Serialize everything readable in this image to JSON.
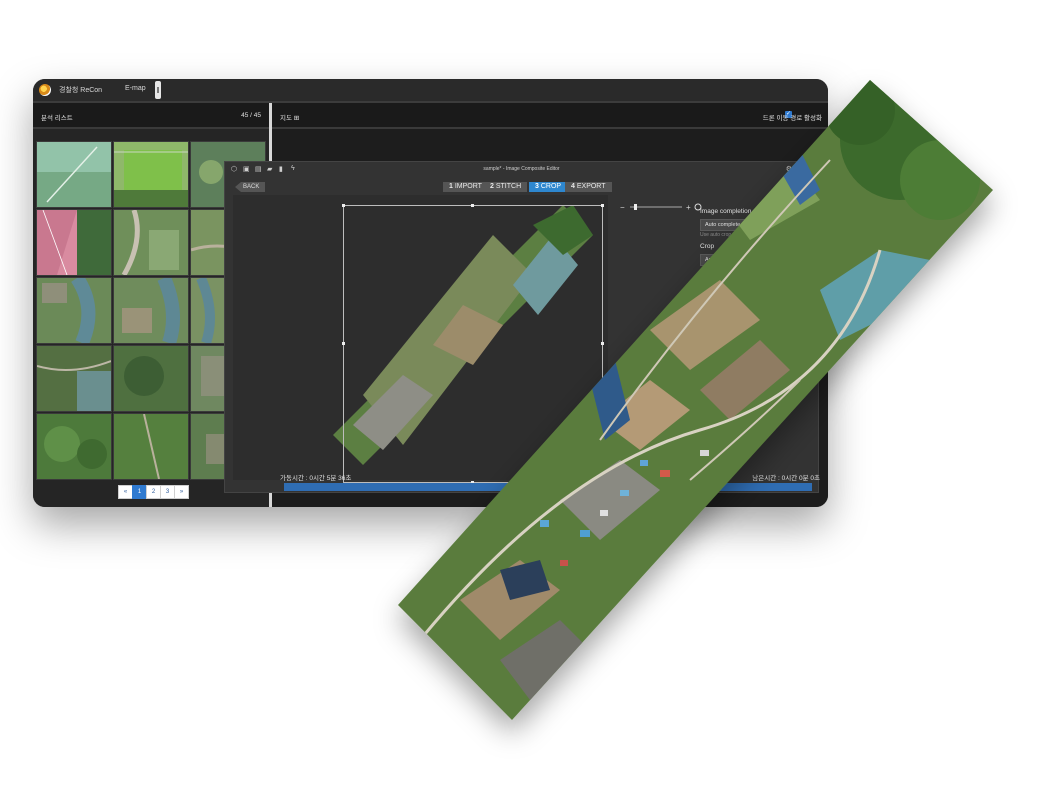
{
  "header": {
    "app_title": "경찰청 ReCon",
    "nav_tabs": [
      "E-map"
    ]
  },
  "left_panel": {
    "title": "분석 리스트",
    "count": "45 / 45",
    "pagination": [
      "«",
      "1",
      "2",
      "3",
      "»"
    ],
    "active_page": "1"
  },
  "map_panel": {
    "title": "지도 ⊞",
    "route_toggle_label": "드론 이동 경로 활성화",
    "route_toggle_checked": true
  },
  "editor": {
    "title": "sample* - Image Composite Editor",
    "back_label": "BACK",
    "steps": [
      {
        "num": "1",
        "label": "IMPORT"
      },
      {
        "num": "2",
        "label": "STITCH"
      },
      {
        "num": "3",
        "label": "CROP"
      },
      {
        "num": "4",
        "label": "EXPORT"
      }
    ],
    "active_step": "3",
    "side": {
      "image_completion_label": "Image completion",
      "auto_complete_label": "Auto complete",
      "use_auto_label": "Use auto crop",
      "crop_label": "Crop",
      "auto_label": "Auto"
    }
  },
  "status": {
    "elapsed": "가동시간 : 0시간 5분 36초",
    "remaining": "남은시간 : 0시간 0분 0초",
    "progress": 1.0
  },
  "colors": {
    "accent": "#2e87cf",
    "progress": "#2f6db3",
    "background": "#1f1f1f"
  }
}
